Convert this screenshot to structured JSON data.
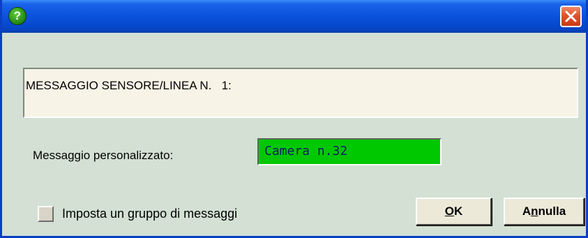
{
  "titlebar": {
    "help_icon_glyph": "?",
    "close_icon": "close-x-icon",
    "accent": "#0a52dd",
    "close_color": "#e2532a"
  },
  "message": {
    "text": "MESSAGGIO SENSORE/LINEA N.   1:"
  },
  "custom_message": {
    "label": "Messaggio personalizzato:",
    "value": "Camera n.32",
    "field_color": "#00c800"
  },
  "group": {
    "checkbox_label": "Imposta un gruppo di messaggi",
    "checked": false
  },
  "buttons": {
    "ok": {
      "mnemonic": "O",
      "rest": "K"
    },
    "cancel": {
      "before": "A",
      "mnemonic": "n",
      "rest": "nulla"
    }
  }
}
